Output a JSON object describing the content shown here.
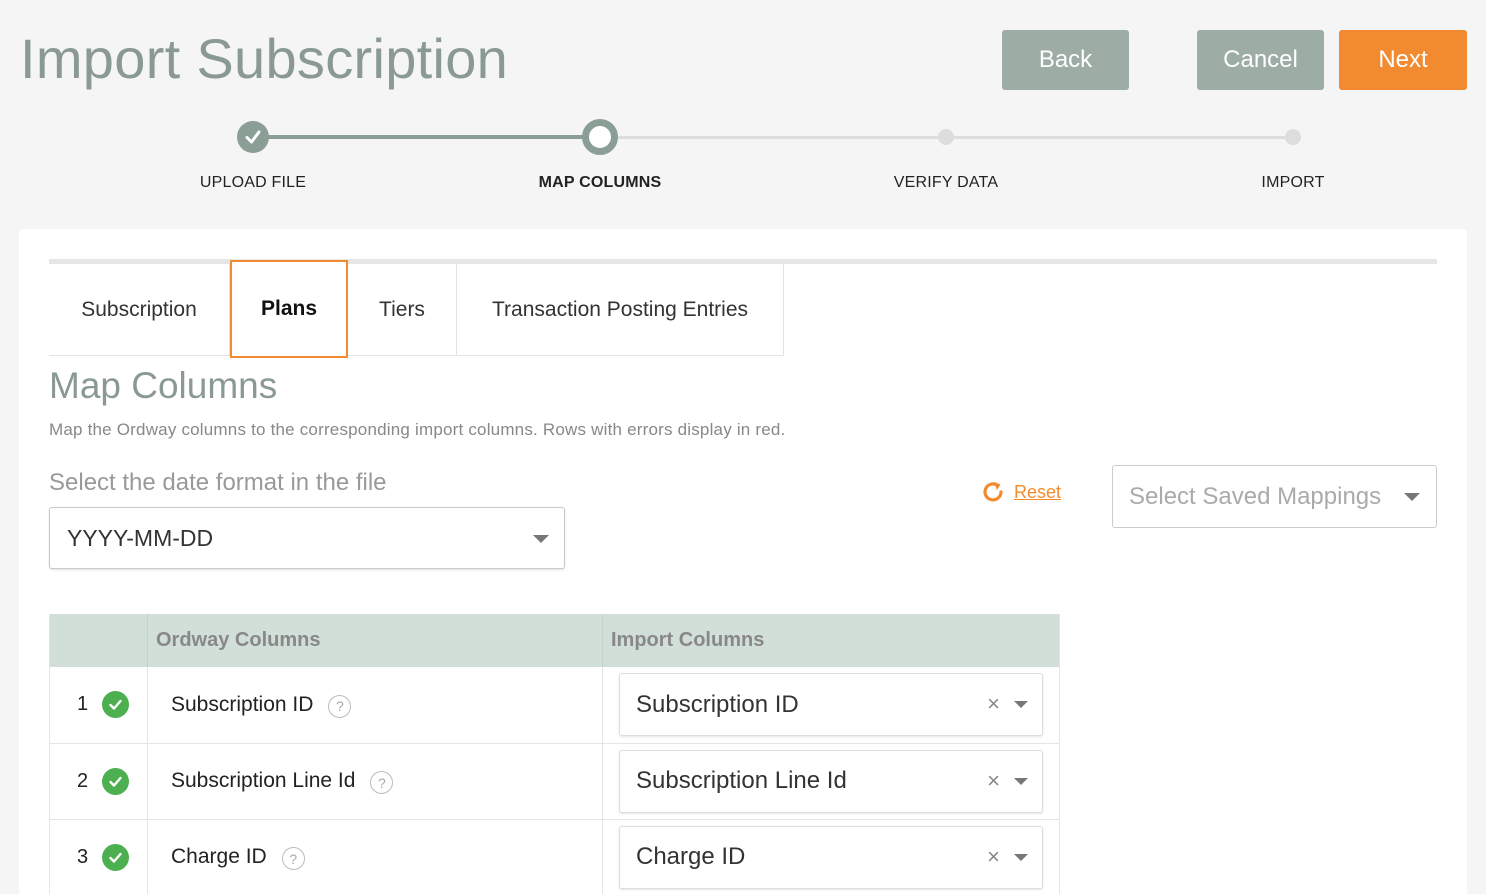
{
  "header": {
    "title": "Import Subscription",
    "back_label": "Back",
    "cancel_label": "Cancel",
    "next_label": "Next"
  },
  "stepper": {
    "steps": [
      {
        "label": "UPLOAD FILE",
        "state": "done"
      },
      {
        "label": "MAP COLUMNS",
        "state": "current"
      },
      {
        "label": "VERIFY DATA",
        "state": "pending"
      },
      {
        "label": "IMPORT",
        "state": "pending"
      }
    ],
    "done_icon": "check-icon"
  },
  "tabs": [
    {
      "label": "Subscription",
      "active": false
    },
    {
      "label": "Plans",
      "active": true
    },
    {
      "label": "Tiers",
      "active": false
    },
    {
      "label": "Transaction Posting Entries",
      "active": false
    }
  ],
  "main": {
    "section_title": "Map Columns",
    "description": "Map the Ordway columns to the corresponding import columns. Rows with errors display in red.",
    "date_format_label": "Select the date format in the file",
    "date_format_value": "YYYY-MM-DD",
    "reset_label": "Reset",
    "saved_mappings_placeholder": "Select Saved Mappings"
  },
  "table": {
    "headers": [
      "",
      "Ordway Columns",
      "Import Columns"
    ],
    "rows": [
      {
        "num": "1",
        "status": "valid",
        "ordway": "Subscription ID",
        "import": "Subscription ID"
      },
      {
        "num": "2",
        "status": "valid",
        "ordway": "Subscription Line Id",
        "import": "Subscription Line Id"
      },
      {
        "num": "3",
        "status": "valid",
        "ordway": "Charge ID",
        "import": "Charge ID"
      }
    ],
    "help_glyph": "?",
    "clear_glyph": "×"
  },
  "colors": {
    "accent": "#f28b30",
    "muted_button": "#9dada5",
    "step_done": "#8a9e95",
    "table_header": "#d2dfd8",
    "valid_status": "#4caf50"
  }
}
